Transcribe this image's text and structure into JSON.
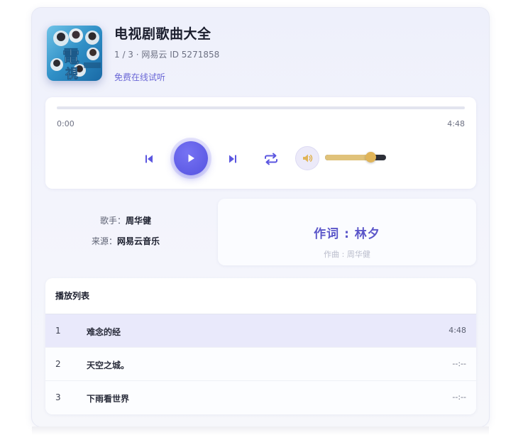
{
  "album": {
    "title": "电视剧歌曲大全",
    "meta": "1 / 3 · 网易云 ID 5271858",
    "trial_link": "免费在线试听",
    "cover_icon": "album-cover-image"
  },
  "player": {
    "current_time": "0:00",
    "total_time": "4:48",
    "progress": 0,
    "volume": 0.75,
    "icons": {
      "prev": "skip-previous-icon",
      "play": "play-icon",
      "next": "skip-next-icon",
      "loop": "repeat-icon",
      "volume": "volume-icon"
    },
    "colors": {
      "accent": "#5b56e0",
      "volume_fill": "#e0c27a"
    }
  },
  "info": {
    "singer_label": "歌手：",
    "singer": "周华健",
    "source_label": "来源：",
    "source": "网易云音乐"
  },
  "lyrics": {
    "current_line": "作词 : 林夕",
    "next_line": "作曲 : 周华健"
  },
  "playlist": {
    "title": "播放列表",
    "items": [
      {
        "index": "1",
        "name": "难念的经",
        "duration": "4:48"
      },
      {
        "index": "2",
        "name": "天空之城。",
        "duration": "--:--"
      },
      {
        "index": "3",
        "name": "下雨看世界",
        "duration": "--:--"
      }
    ]
  }
}
